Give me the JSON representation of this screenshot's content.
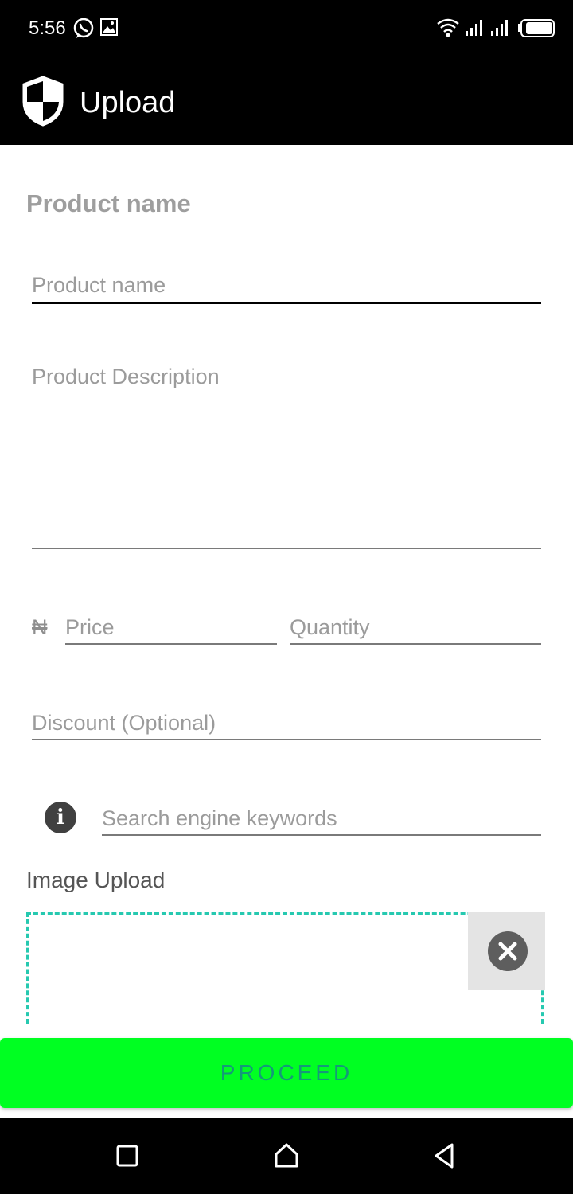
{
  "status_bar": {
    "time": "5:56",
    "icons": [
      "whatsapp-icon",
      "gallery-icon",
      "wifi-icon",
      "signal-icon",
      "signal-icon",
      "battery-icon"
    ]
  },
  "app_bar": {
    "title": "Upload",
    "logo_icon": "shield-icon"
  },
  "form": {
    "section_title": "Product name",
    "product_name": {
      "value": "",
      "placeholder": "Product name"
    },
    "description": {
      "value": "",
      "placeholder": "Product Description"
    },
    "currency_symbol": "₦",
    "price": {
      "value": "",
      "placeholder": "Price"
    },
    "quantity": {
      "value": "",
      "placeholder": "Quantity"
    },
    "discount": {
      "value": "",
      "placeholder": "Discount (Optional)"
    },
    "keywords": {
      "value": "",
      "placeholder": "Search engine keywords"
    },
    "info_icon_glyph": "i",
    "image_upload_label": "Image Upload"
  },
  "actions": {
    "proceed_label": "PROCEED"
  },
  "nav_bar": {
    "icons": [
      "recents-icon",
      "home-icon",
      "back-icon"
    ]
  },
  "colors": {
    "accent_green": "#00ff22",
    "proceed_text": "#14997a",
    "dashed_border": "#26c9b0",
    "bar_background": "#000000"
  }
}
